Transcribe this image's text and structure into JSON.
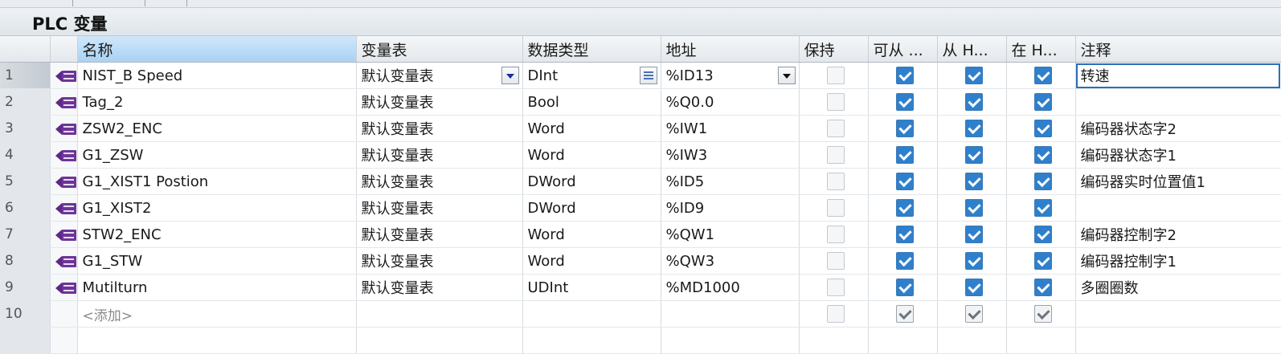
{
  "title": "PLC 变量",
  "columns": {
    "name": "名称",
    "table": "变量表",
    "datatype": "数据类型",
    "address": "地址",
    "retain": "保持",
    "accessible": "可从 ...",
    "writable": "从 H...",
    "visible": "在 H...",
    "comment": "注释"
  },
  "rows": [
    {
      "num": "1",
      "name": "NIST_B Speed",
      "table": "默认变量表",
      "datatype": "DInt",
      "address": "%ID13",
      "comment": "转速",
      "retain": false,
      "accessible": true,
      "writable": true,
      "visible": true
    },
    {
      "num": "2",
      "name": "Tag_2",
      "table": "默认变量表",
      "datatype": "Bool",
      "address": "%Q0.0",
      "comment": "",
      "retain": false,
      "accessible": true,
      "writable": true,
      "visible": true
    },
    {
      "num": "3",
      "name": "ZSW2_ENC",
      "table": "默认变量表",
      "datatype": "Word",
      "address": "%IW1",
      "comment": "编码器状态字2",
      "retain": false,
      "accessible": true,
      "writable": true,
      "visible": true
    },
    {
      "num": "4",
      "name": "G1_ZSW",
      "table": "默认变量表",
      "datatype": "Word",
      "address": "%IW3",
      "comment": "编码器状态字1",
      "retain": false,
      "accessible": true,
      "writable": true,
      "visible": true
    },
    {
      "num": "5",
      "name": "G1_XIST1 Postion",
      "table": "默认变量表",
      "datatype": "DWord",
      "address": "%ID5",
      "comment": "编码器实时位置值1",
      "retain": false,
      "accessible": true,
      "writable": true,
      "visible": true
    },
    {
      "num": "6",
      "name": "G1_XIST2",
      "table": "默认变量表",
      "datatype": "DWord",
      "address": "%ID9",
      "comment": "",
      "retain": false,
      "accessible": true,
      "writable": true,
      "visible": true
    },
    {
      "num": "7",
      "name": "STW2_ENC",
      "table": "默认变量表",
      "datatype": "Word",
      "address": "%QW1",
      "comment": "编码器控制字2",
      "retain": false,
      "accessible": true,
      "writable": true,
      "visible": true
    },
    {
      "num": "8",
      "name": "G1_STW",
      "table": "默认变量表",
      "datatype": "Word",
      "address": "%QW3",
      "comment": "编码器控制字1",
      "retain": false,
      "accessible": true,
      "writable": true,
      "visible": true
    },
    {
      "num": "9",
      "name": "Mutilturn",
      "table": "默认变量表",
      "datatype": "UDInt",
      "address": "%MD1000",
      "comment": "多圈圈数",
      "retain": false,
      "accessible": true,
      "writable": true,
      "visible": true
    }
  ],
  "add_row": {
    "num": "10",
    "label": "<添加>"
  },
  "icons": {
    "tag": "plc-tag-icon",
    "dropdown": "dropdown-arrow-icon",
    "list": "list-icon",
    "checkbox": "checkbox-icon"
  }
}
